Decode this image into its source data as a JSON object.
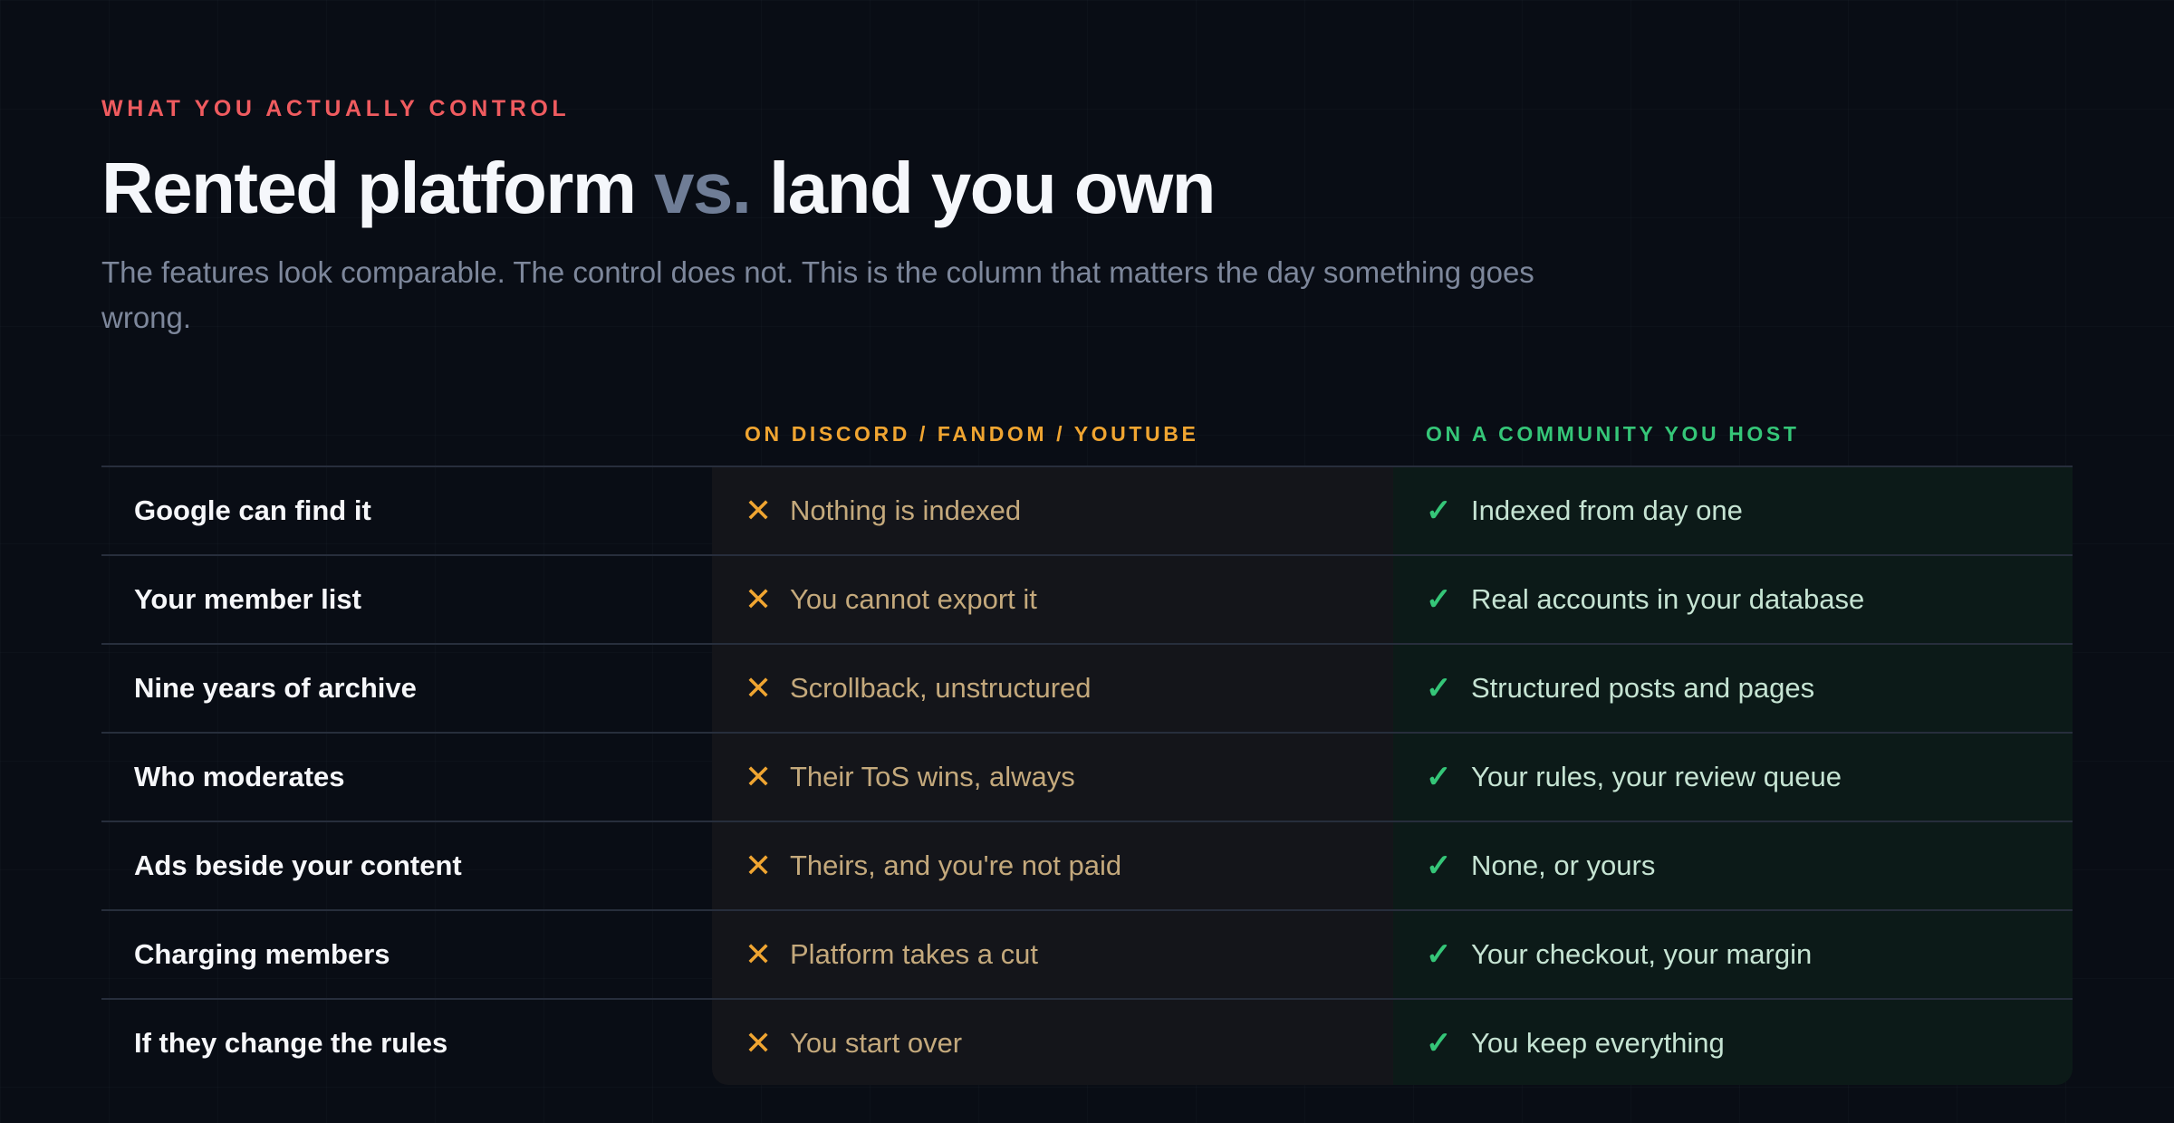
{
  "eyebrow": "WHAT YOU ACTUALLY CONTROL",
  "title": {
    "part1": "Rented platform ",
    "vs": "vs.",
    "part2": " land you own"
  },
  "subtitle": "The features look comparable. The control does not. This is the column that matters the day something goes wrong.",
  "columns": {
    "rented": "ON DISCORD / FANDOM / YOUTUBE",
    "owned": "ON A COMMUNITY YOU HOST"
  },
  "icons": {
    "rented": "✕",
    "owned": "✓"
  },
  "rows": [
    {
      "label": "Google can find it",
      "rented": "Nothing is indexed",
      "owned": "Indexed from day one"
    },
    {
      "label": "Your member list",
      "rented": "You cannot export it",
      "owned": "Real accounts in your database"
    },
    {
      "label": "Nine years of archive",
      "rented": "Scrollback, unstructured",
      "owned": "Structured posts and pages"
    },
    {
      "label": "Who moderates",
      "rented": "Their ToS wins, always",
      "owned": "Your rules, your review queue"
    },
    {
      "label": "Ads beside your content",
      "rented": "Theirs, and you're not paid",
      "owned": "None, or yours"
    },
    {
      "label": "Charging members",
      "rented": "Platform takes a cut",
      "owned": "Your checkout, your margin"
    },
    {
      "label": "If they change the rules",
      "rented": "You start over",
      "owned": "You keep everything"
    }
  ],
  "colors": {
    "background": "#090d15",
    "eyebrow": "#ef5b5f",
    "rented_accent": "#f0a531",
    "owned_accent": "#35c678"
  }
}
